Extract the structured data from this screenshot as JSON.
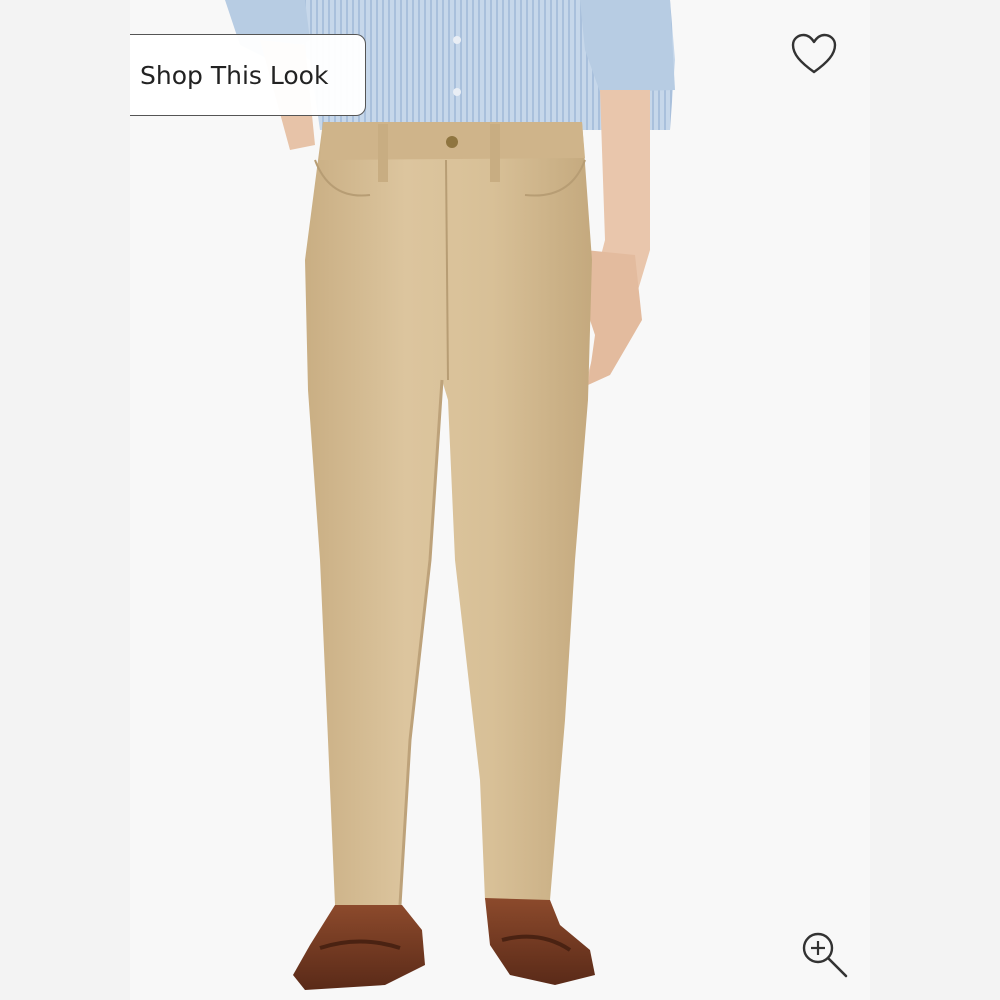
{
  "overlay": {
    "shop_label": "Shop This Look",
    "wishlist_icon": "heart-outline-icon",
    "zoom_icon": "zoom-in-icon"
  },
  "colors": {
    "pants": "#d4bc93",
    "shirt": "#bcd0e4",
    "shoes": "#7a3a22",
    "background": "#f8f8f8"
  }
}
